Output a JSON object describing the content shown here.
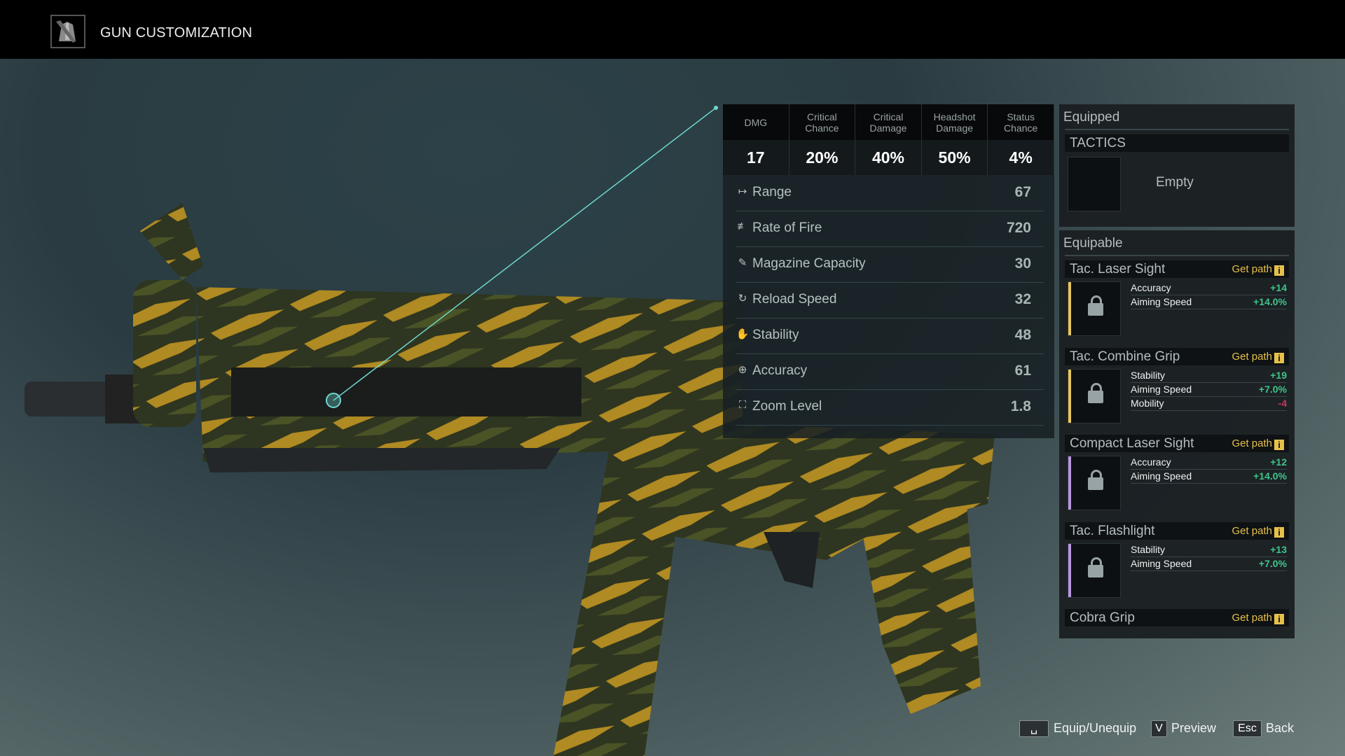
{
  "header": {
    "title": "GUN CUSTOMIZATION",
    "icon": "gear-jacket-wrench-icon"
  },
  "stats": {
    "headers": [
      "DMG",
      "Critical\nChance",
      "Critical\nDamage",
      "Headshot\nDamage",
      "Status\nChance"
    ],
    "values": [
      "17",
      "20%",
      "40%",
      "50%",
      "4%"
    ],
    "rows": [
      {
        "icon": "range-icon",
        "glyph": "↦",
        "label": "Range",
        "value": "67"
      },
      {
        "icon": "rate-of-fire-icon",
        "glyph": "≢",
        "label": "Rate of Fire",
        "value": "720"
      },
      {
        "icon": "magazine-icon",
        "glyph": "✎",
        "label": "Magazine Capacity",
        "value": "30"
      },
      {
        "icon": "reload-icon",
        "glyph": "↻",
        "label": "Reload Speed",
        "value": "32"
      },
      {
        "icon": "stability-icon",
        "glyph": "✋",
        "label": "Stability",
        "value": "48"
      },
      {
        "icon": "crosshair-icon",
        "glyph": "⊕",
        "label": "Accuracy",
        "value": "61"
      },
      {
        "icon": "zoom-icon",
        "glyph": "⛶",
        "label": "Zoom Level",
        "value": "1.8"
      }
    ]
  },
  "equipped": {
    "title": "Equipped",
    "slot": "TACTICS",
    "empty": "Empty"
  },
  "equipable": {
    "title": "Equipable",
    "get_path": "Get path",
    "info": "i",
    "items": [
      {
        "name": "Tac. Laser Sight",
        "rarity_color": "#e8c65a",
        "stats": [
          {
            "k": "Accuracy",
            "v": "+14",
            "pos": true
          },
          {
            "k": "Aiming Speed",
            "v": "+14.0%",
            "pos": true
          }
        ]
      },
      {
        "name": "Tac. Combine Grip",
        "rarity_color": "#e8c65a",
        "stats": [
          {
            "k": "Stability",
            "v": "+19",
            "pos": true
          },
          {
            "k": "Aiming Speed",
            "v": "+7.0%",
            "pos": true
          },
          {
            "k": "Mobility",
            "v": "-4",
            "pos": false
          }
        ]
      },
      {
        "name": "Compact Laser Sight",
        "rarity_color": "#b996e0",
        "stats": [
          {
            "k": "Accuracy",
            "v": "+12",
            "pos": true
          },
          {
            "k": "Aiming Speed",
            "v": "+14.0%",
            "pos": true
          }
        ]
      },
      {
        "name": "Tac. Flashlight",
        "rarity_color": "#b996e0",
        "stats": [
          {
            "k": "Stability",
            "v": "+13",
            "pos": true
          },
          {
            "k": "Aiming Speed",
            "v": "+7.0%",
            "pos": true
          }
        ]
      },
      {
        "name": "Cobra Grip",
        "rarity_color": "#b996e0",
        "stats": []
      }
    ]
  },
  "hints": [
    {
      "key": "␣",
      "label": "Equip/Unequip"
    },
    {
      "key": "V",
      "label": "Preview"
    },
    {
      "key": "Esc",
      "label": "Back"
    }
  ],
  "colors": {
    "positive": "#3fc48a",
    "negative": "#c8365e",
    "accent": "#e6c04a",
    "pointer": "#6fd6cf"
  }
}
